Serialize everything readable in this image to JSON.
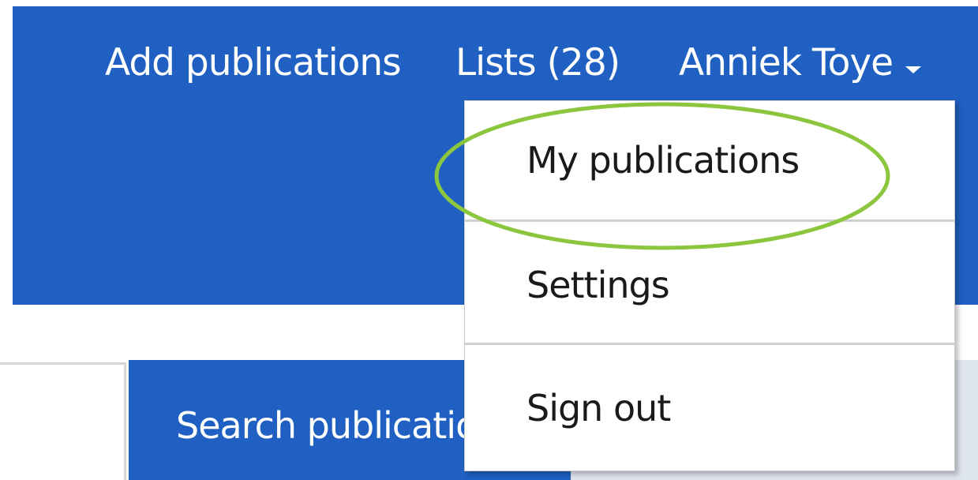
{
  "header": {
    "nav": {
      "add_publications": "Add publications",
      "lists": "Lists (28)",
      "user_name": "Anniek Toye"
    },
    "user_menu": {
      "items": [
        {
          "label": "My publications"
        },
        {
          "label": "Settings"
        },
        {
          "label": "Sign out"
        }
      ]
    },
    "colors": {
      "header_bg": "#1f60c2",
      "highlight": "#8cc63f"
    }
  },
  "search": {
    "button_label": "Search publications"
  },
  "icons": {
    "user_menu_caret": "caret-down-icon"
  }
}
